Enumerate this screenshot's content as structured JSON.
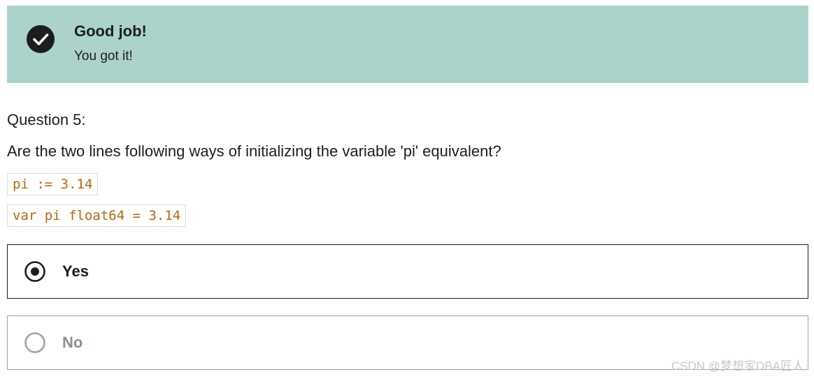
{
  "banner": {
    "icon": "check-circle-icon",
    "title": "Good job!",
    "subtitle": "You got it!",
    "color": "#acd2cc"
  },
  "question": {
    "label": "Question 5:",
    "text": "Are the two lines following ways of initializing the variable 'pi' equivalent?",
    "code_lines": [
      "pi := 3.14",
      "var pi float64 = 3.14"
    ]
  },
  "options": [
    {
      "label": "Yes",
      "selected": true,
      "icon": "radio-selected-icon"
    },
    {
      "label": "No",
      "selected": false,
      "icon": "radio-empty-icon"
    }
  ],
  "watermark": "CSDN @梦想家DBA匠人",
  "colors": {
    "code_text": "#b4690e",
    "text": "#1c1d1f",
    "muted": "#8a8f93"
  }
}
